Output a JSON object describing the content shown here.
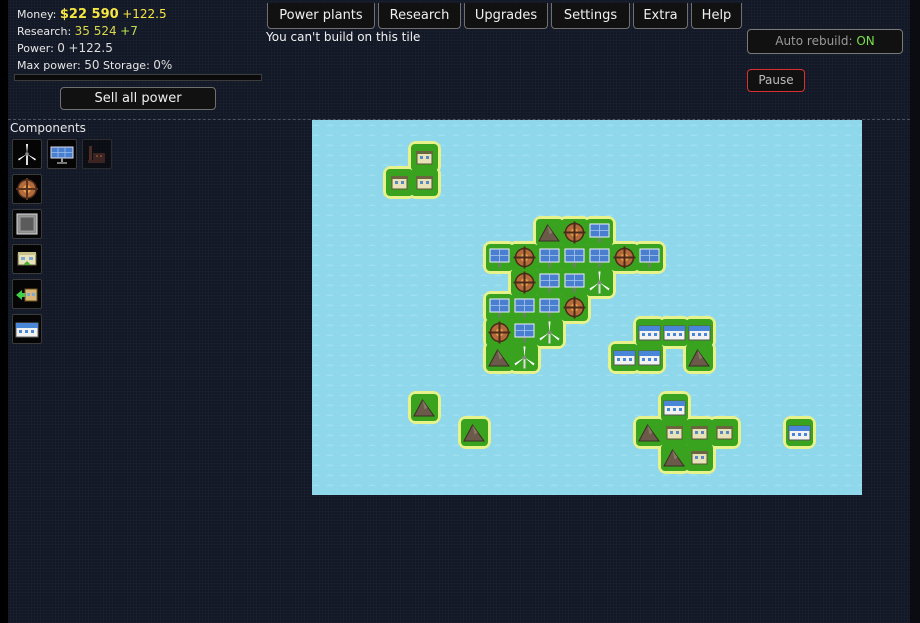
{
  "stats": {
    "money_label": "Money:",
    "money_value": "$22 590",
    "money_delta": "+122.5",
    "research_label": "Research:",
    "research_value": "35 524",
    "research_delta": "+7",
    "power_label": "Power:",
    "power_value": "0",
    "power_delta": "+122.5",
    "maxpower_label": "Max power:",
    "maxpower_value": "50",
    "storage_label": "Storage:",
    "storage_value": "0%",
    "storage_fill_percent": 0
  },
  "sell_button": "Sell all power",
  "nav": {
    "power_plants": "Power plants",
    "research": "Research",
    "upgrades": "Upgrades",
    "settings": "Settings",
    "extra": "Extra",
    "help": "Help"
  },
  "notice": "You can't build on this tile",
  "auto_rebuild": {
    "label": "Auto rebuild:",
    "state": "ON"
  },
  "pause_button": "Pause",
  "components": {
    "title": "Components",
    "items": [
      "wind-turbine-icon",
      "solar-panel-icon",
      "coal-plant-icon",
      "heat-sink-icon",
      "battery-icon",
      "office-icon",
      "power-seller-icon",
      "research-lab-icon"
    ]
  },
  "colors": {
    "water": "#8fd8ec",
    "grass": "#39a31f",
    "money": "#f5e642",
    "on": "#7adf4a",
    "pause_border": "#d83030"
  },
  "map": {
    "cols": 22,
    "rows": 15,
    "islands": [
      [
        [
          4,
          1
        ],
        [
          4,
          2
        ],
        [
          3,
          2
        ]
      ],
      [
        [
          9,
          4
        ],
        [
          10,
          4
        ],
        [
          11,
          4
        ],
        [
          7,
          5
        ],
        [
          8,
          5
        ],
        [
          9,
          5
        ],
        [
          10,
          5
        ],
        [
          11,
          5
        ],
        [
          12,
          5
        ],
        [
          13,
          5
        ],
        [
          8,
          6
        ],
        [
          9,
          6
        ],
        [
          10,
          6
        ],
        [
          11,
          6
        ],
        [
          7,
          7
        ],
        [
          8,
          7
        ],
        [
          9,
          7
        ],
        [
          10,
          7
        ],
        [
          7,
          8
        ],
        [
          8,
          8
        ],
        [
          9,
          8
        ],
        [
          7,
          9
        ],
        [
          8,
          9
        ]
      ],
      [
        [
          13,
          8
        ],
        [
          14,
          8
        ],
        [
          15,
          8
        ],
        [
          12,
          9
        ],
        [
          13,
          9
        ],
        [
          15,
          9
        ]
      ],
      [
        [
          4,
          11
        ]
      ],
      [
        [
          6,
          12
        ]
      ],
      [
        [
          14,
          11
        ],
        [
          13,
          12
        ],
        [
          14,
          12
        ],
        [
          15,
          12
        ],
        [
          16,
          12
        ],
        [
          14,
          13
        ],
        [
          15,
          13
        ]
      ],
      [
        [
          19,
          12
        ]
      ]
    ],
    "buildings": [
      {
        "t": "house",
        "c": 4,
        "r": 1
      },
      {
        "t": "house",
        "c": 3,
        "r": 2
      },
      {
        "t": "house",
        "c": 4,
        "r": 2
      },
      {
        "t": "mine",
        "c": 9,
        "r": 4
      },
      {
        "t": "heat",
        "c": 10,
        "r": 4
      },
      {
        "t": "solar",
        "c": 11,
        "r": 4
      },
      {
        "t": "solar",
        "c": 7,
        "r": 5
      },
      {
        "t": "heat",
        "c": 8,
        "r": 5
      },
      {
        "t": "solar",
        "c": 9,
        "r": 5
      },
      {
        "t": "solar",
        "c": 10,
        "r": 5
      },
      {
        "t": "solar",
        "c": 11,
        "r": 5
      },
      {
        "t": "heat",
        "c": 12,
        "r": 5
      },
      {
        "t": "solar",
        "c": 13,
        "r": 5
      },
      {
        "t": "heat",
        "c": 8,
        "r": 6
      },
      {
        "t": "solar",
        "c": 9,
        "r": 6
      },
      {
        "t": "solar",
        "c": 10,
        "r": 6
      },
      {
        "t": "wind",
        "c": 11,
        "r": 6
      },
      {
        "t": "solar",
        "c": 7,
        "r": 7
      },
      {
        "t": "solar",
        "c": 8,
        "r": 7
      },
      {
        "t": "solar",
        "c": 9,
        "r": 7
      },
      {
        "t": "heat",
        "c": 10,
        "r": 7
      },
      {
        "t": "heat",
        "c": 7,
        "r": 8
      },
      {
        "t": "solar",
        "c": 8,
        "r": 8
      },
      {
        "t": "wind",
        "c": 9,
        "r": 8
      },
      {
        "t": "mine",
        "c": 7,
        "r": 9
      },
      {
        "t": "wind",
        "c": 8,
        "r": 9
      },
      {
        "t": "lab",
        "c": 13,
        "r": 8
      },
      {
        "t": "lab",
        "c": 14,
        "r": 8
      },
      {
        "t": "lab",
        "c": 15,
        "r": 8
      },
      {
        "t": "lab",
        "c": 12,
        "r": 9
      },
      {
        "t": "lab",
        "c": 13,
        "r": 9
      },
      {
        "t": "mine",
        "c": 15,
        "r": 9
      },
      {
        "t": "mine",
        "c": 4,
        "r": 11
      },
      {
        "t": "mine",
        "c": 6,
        "r": 12
      },
      {
        "t": "lab",
        "c": 14,
        "r": 11
      },
      {
        "t": "mine",
        "c": 13,
        "r": 12
      },
      {
        "t": "house",
        "c": 14,
        "r": 12
      },
      {
        "t": "house",
        "c": 15,
        "r": 12
      },
      {
        "t": "house",
        "c": 16,
        "r": 12
      },
      {
        "t": "mine",
        "c": 14,
        "r": 13
      },
      {
        "t": "house",
        "c": 15,
        "r": 13
      },
      {
        "t": "lab",
        "c": 19,
        "r": 12
      }
    ]
  }
}
